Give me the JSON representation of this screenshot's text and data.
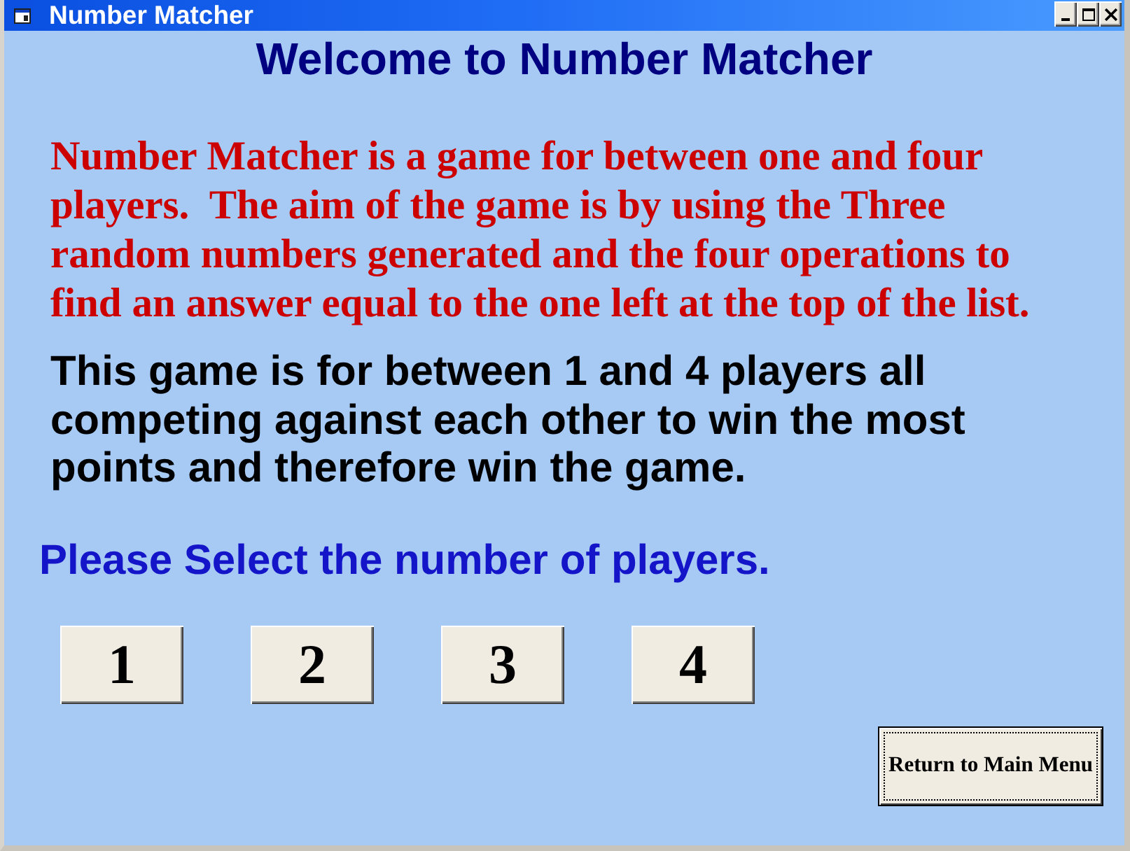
{
  "window": {
    "title": "Number Matcher"
  },
  "heading": "Welcome to Number Matcher",
  "intro": "Number Matcher is a game for between one and four players.  The aim of the game is by using the Three random numbers generated and the four operations to find an answer equal to the one left at the top of the list.",
  "description": "This game is for between 1 and 4 players all competing against each other to win the most points and therefore win the game.",
  "prompt": "Please Select the number of players.",
  "player_buttons": [
    {
      "label": "1"
    },
    {
      "label": "2"
    },
    {
      "label": "3"
    },
    {
      "label": "4"
    }
  ],
  "return_button": {
    "label": "Return to Main Menu",
    "focused": true
  }
}
